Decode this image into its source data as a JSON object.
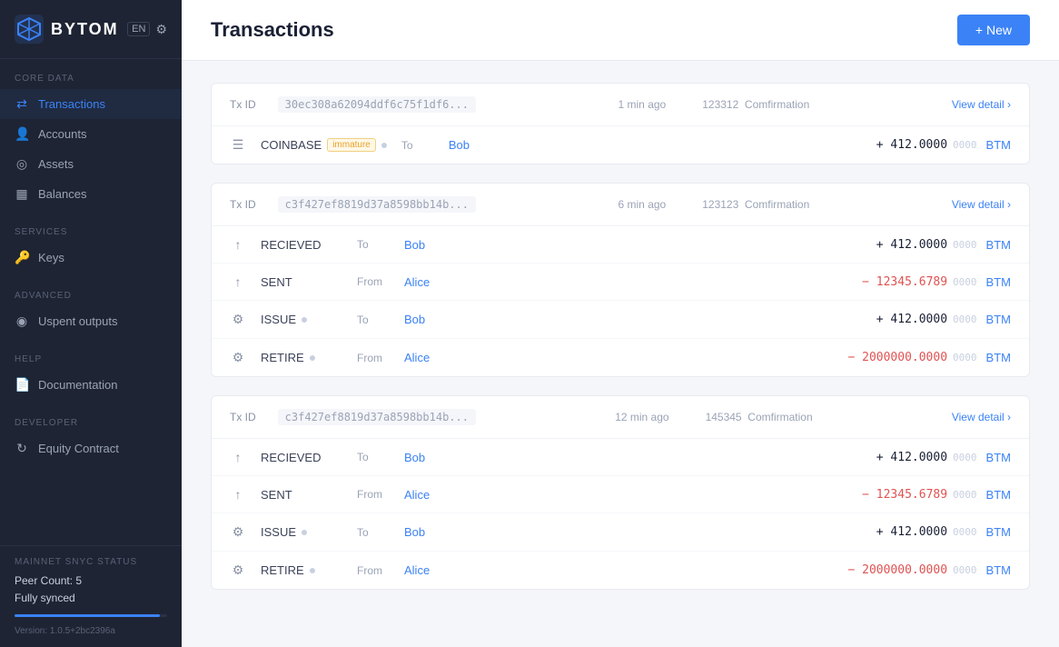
{
  "app": {
    "logo": "BYTOM",
    "lang": "EN",
    "version": "Version: 1.0.5+2bc2396a"
  },
  "sidebar": {
    "sections": [
      {
        "label": "CORE DATA",
        "items": [
          {
            "id": "transactions",
            "label": "Transactions",
            "icon": "⇄",
            "active": true
          },
          {
            "id": "accounts",
            "label": "Accounts",
            "icon": "👤"
          },
          {
            "id": "assets",
            "label": "Assets",
            "icon": "◎"
          },
          {
            "id": "balances",
            "label": "Balances",
            "icon": "▦"
          }
        ]
      },
      {
        "label": "SERVICES",
        "items": [
          {
            "id": "keys",
            "label": "Keys",
            "icon": "🔑"
          }
        ]
      },
      {
        "label": "ADVANCED",
        "items": [
          {
            "id": "unspent",
            "label": "Uspent outputs",
            "icon": "◉"
          }
        ]
      },
      {
        "label": "HELP",
        "items": [
          {
            "id": "documentation",
            "label": "Documentation",
            "icon": "📄"
          }
        ]
      },
      {
        "label": "DEVELOPER",
        "items": [
          {
            "id": "equity",
            "label": "Equity Contract",
            "icon": "↻"
          }
        ]
      }
    ],
    "sync": {
      "label": "MAINNET SNYC STATUS",
      "peer_count": "Peer Count: 5",
      "status": "Fully synced"
    }
  },
  "header": {
    "title": "Transactions",
    "new_button": "+ New"
  },
  "transactions": [
    {
      "id": "tx1",
      "tx_id_label": "Tx ID",
      "tx_id_value": "30ec308a62094ddf6c75f1df6...",
      "time": "1 min ago",
      "confirmations": "123312",
      "confirmation_label": "Comfirmation",
      "view_detail": "View detail",
      "rows": [
        {
          "icon": "☰",
          "type": "COINBASE",
          "badge": "immature",
          "direction": "To",
          "address": "Bob",
          "amount_sign": "+",
          "amount_main": "412.0000",
          "amount_small": "0000",
          "currency": "BTM",
          "positive": true
        }
      ]
    },
    {
      "id": "tx2",
      "tx_id_label": "Tx ID",
      "tx_id_value": "c3f427ef8819d37a8598bb14b...",
      "time": "6 min ago",
      "confirmations": "123123",
      "confirmation_label": "Comfirmation",
      "view_detail": "View detail",
      "rows": [
        {
          "icon": "↑",
          "type": "RECIEVED",
          "badge": null,
          "direction": "To",
          "address": "Bob",
          "amount_sign": "+",
          "amount_main": "412.0000",
          "amount_small": "0000",
          "currency": "BTM",
          "positive": true
        },
        {
          "icon": "↑",
          "type": "SENT",
          "badge": null,
          "direction": "From",
          "address": "Alice",
          "amount_sign": "−",
          "amount_main": "12345.6789",
          "amount_small": "0000",
          "currency": "BTM",
          "positive": false
        },
        {
          "icon": "⚙",
          "type": "ISSUE",
          "badge": "dot",
          "direction": "To",
          "address": "Bob",
          "amount_sign": "+",
          "amount_main": "412.0000",
          "amount_small": "0000",
          "currency": "BTM",
          "positive": true
        },
        {
          "icon": "⚙",
          "type": "RETIRE",
          "badge": "dot",
          "direction": "From",
          "address": "Alice",
          "amount_sign": "−",
          "amount_main": "2000000.0000",
          "amount_small": "0000",
          "currency": "BTM",
          "positive": false
        }
      ]
    },
    {
      "id": "tx3",
      "tx_id_label": "Tx ID",
      "tx_id_value": "c3f427ef8819d37a8598bb14b...",
      "time": "12 min ago",
      "confirmations": "145345",
      "confirmation_label": "Comfirmation",
      "view_detail": "View detail",
      "rows": [
        {
          "icon": "↑",
          "type": "RECIEVED",
          "badge": null,
          "direction": "To",
          "address": "Bob",
          "amount_sign": "+",
          "amount_main": "412.0000",
          "amount_small": "0000",
          "currency": "BTM",
          "positive": true
        },
        {
          "icon": "↑",
          "type": "SENT",
          "badge": null,
          "direction": "From",
          "address": "Alice",
          "amount_sign": "−",
          "amount_main": "12345.6789",
          "amount_small": "0000",
          "currency": "BTM",
          "positive": false
        },
        {
          "icon": "⚙",
          "type": "ISSUE",
          "badge": "dot",
          "direction": "To",
          "address": "Bob",
          "amount_sign": "+",
          "amount_main": "412.0000",
          "amount_small": "0000",
          "currency": "BTM",
          "positive": true
        },
        {
          "icon": "⚙",
          "type": "RETIRE",
          "badge": "dot",
          "direction": "From",
          "address": "Alice",
          "amount_sign": "−",
          "amount_main": "2000000.0000",
          "amount_small": "0000",
          "currency": "BTM",
          "positive": false
        }
      ]
    }
  ]
}
